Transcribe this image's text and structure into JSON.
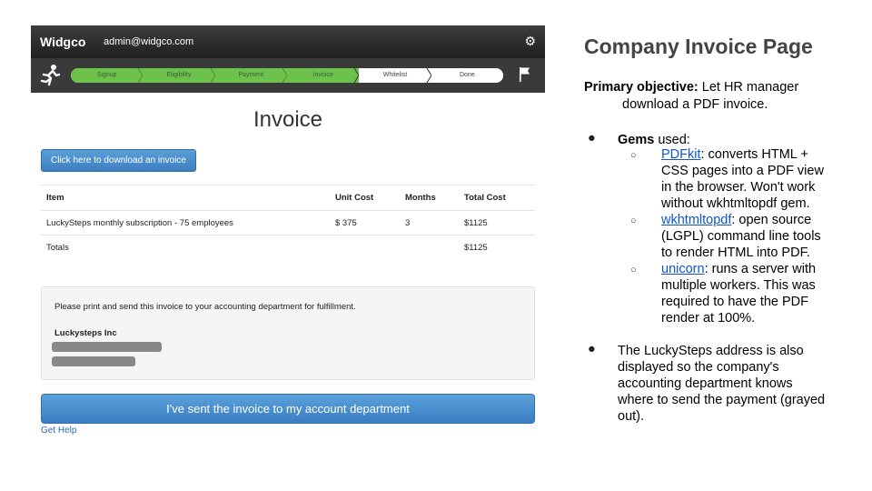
{
  "app": {
    "brand": "Widgco",
    "email": "admin@widgco.com",
    "steps": [
      "Signup",
      "Eligibility",
      "Payment",
      "Invoice",
      "Whitelist",
      "Done"
    ],
    "title": "Invoice",
    "download_button": "Click here to download an invoice",
    "table": {
      "headers": [
        "Item",
        "Unit Cost",
        "Months",
        "Total Cost"
      ],
      "rows": [
        [
          "LuckySteps monthly subscription - 75 employees",
          "$ 375",
          "3",
          "$1125"
        ]
      ],
      "totals": {
        "label": "Totals",
        "total": "$1125"
      }
    },
    "note": "Please print and send this invoice to your accounting department for fulfillment.",
    "company": "Luckysteps Inc",
    "sent_button": "I've sent the invoice to my account department",
    "help_link": "Get Help"
  },
  "slide": {
    "title": "Company Invoice Page",
    "objective_label": "Primary objective:",
    "objective_text_1": " Let HR manager",
    "objective_text_2": "download a PDF invoice.",
    "gems_label": "Gems",
    "gems_suffix": " used:",
    "gems": [
      {
        "name": "PDFkit",
        "desc_1": ": converts HTML +",
        "desc_2": "CSS pages into a PDF view",
        "desc_3": "in the browser. Won't work",
        "desc_4": "without wkhtmltopdf gem."
      },
      {
        "name": "wkhtmltopdf",
        "desc_1": ": open source",
        "desc_2": "(LGPL) command line tools",
        "desc_3": "to render HTML into PDF."
      },
      {
        "name": "unicorn",
        "desc_1": ": runs a server with",
        "desc_2": "multiple workers. This was",
        "desc_3": "required to have the PDF",
        "desc_4": "render at 100%."
      }
    ],
    "address_note": [
      "The LuckySteps address is also",
      "displayed so the company's",
      "accounting department knows",
      "where to send the payment (grayed",
      "out)."
    ]
  }
}
